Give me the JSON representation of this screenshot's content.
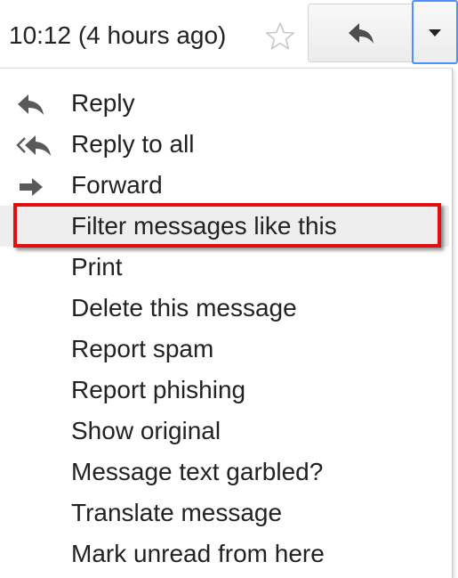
{
  "header": {
    "timestamp": "10:12 (4 hours ago)",
    "star_icon": "star-outline-icon",
    "reply_icon": "reply-arrow-icon",
    "more_icon": "dropdown-triangle-icon"
  },
  "menu": {
    "items": [
      {
        "label": "Reply",
        "icon": "reply-icon"
      },
      {
        "label": "Reply to all",
        "icon": "reply-all-icon"
      },
      {
        "label": "Forward",
        "icon": "forward-icon"
      },
      {
        "label": "Filter messages like this",
        "icon": null
      },
      {
        "label": "Print",
        "icon": null
      },
      {
        "label": "Delete this message",
        "icon": null
      },
      {
        "label": "Report spam",
        "icon": null
      },
      {
        "label": "Report phishing",
        "icon": null
      },
      {
        "label": "Show original",
        "icon": null
      },
      {
        "label": "Message text garbled?",
        "icon": null
      },
      {
        "label": "Translate message",
        "icon": null
      },
      {
        "label": "Mark unread from here",
        "icon": null
      }
    ],
    "highlighted_item": "Filter messages like this"
  },
  "colors": {
    "highlight_border": "#e20e0e",
    "focus_border": "#4d90fe",
    "text": "#222222",
    "icon": "#5a5a5a"
  }
}
